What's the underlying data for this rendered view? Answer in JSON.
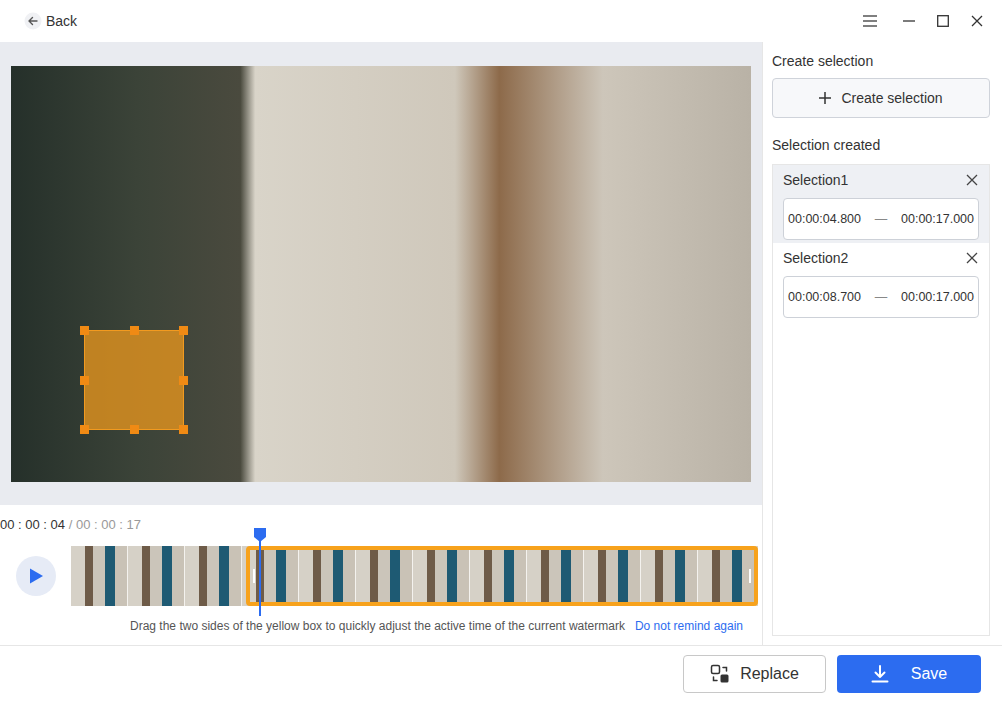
{
  "titlebar": {
    "back": "Back"
  },
  "timeline": {
    "current": "00 : 00 : 04",
    "separator": "/",
    "total": "00 : 00 : 17",
    "playing": false,
    "playhead": {
      "level": 0.275
    },
    "range": {
      "start": 0.255,
      "end": 1
    }
  },
  "hint": {
    "text": "Drag the two sides of the yellow box to quickly adjust the active time of the current watermark",
    "link": "Do not remind again"
  },
  "panel": {
    "create_heading": "Create selection",
    "create_button": "Create selection",
    "created_heading": "Selection created",
    "selections": [
      {
        "label": "Selection1",
        "selected": true,
        "start": "00:00:04.800",
        "separator": "—",
        "end": "00:00:17.000"
      },
      {
        "label": "Selection2",
        "selected": false,
        "start": "00:00:08.700",
        "separator": "—",
        "end": "00:00:17.000"
      }
    ]
  },
  "buttons": {
    "replace": "Replace",
    "save": "Save"
  }
}
